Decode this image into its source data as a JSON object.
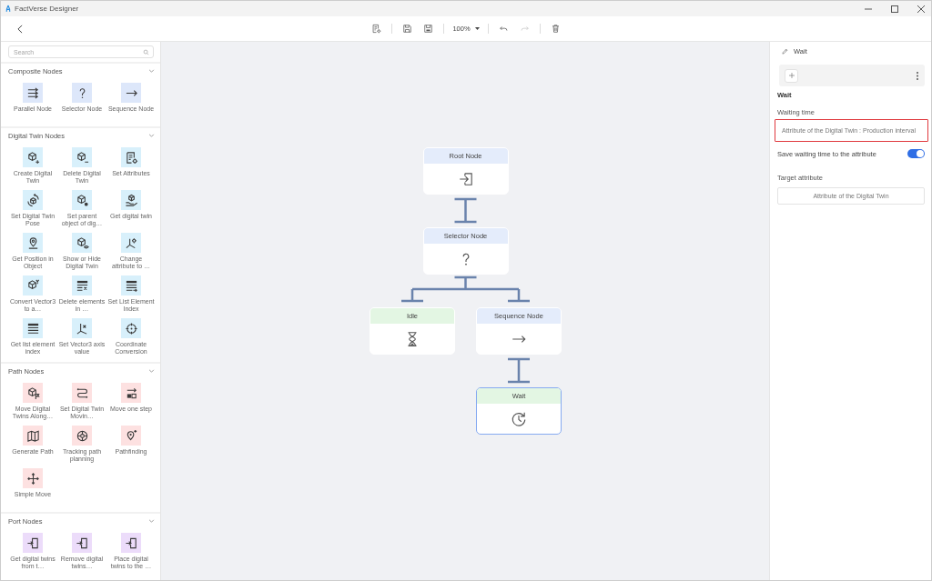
{
  "window": {
    "title": "FactVerse Designer"
  },
  "toolbar": {
    "zoom": "100%",
    "undo": {
      "disabled": false
    },
    "redo": {
      "disabled": true
    }
  },
  "sidebar": {
    "search": {
      "placeholder": "Search"
    },
    "sections": [
      {
        "title": "Composite Nodes",
        "expanded": true,
        "color": "#dde7fa",
        "items": [
          {
            "label": "Parallel Node"
          },
          {
            "label": "Selector Node"
          },
          {
            "label": "Sequence Node"
          }
        ]
      },
      {
        "title": "Digital Twin Nodes",
        "expanded": true,
        "color": "#d8f0fb",
        "items": [
          {
            "label": "Create Digital Twin"
          },
          {
            "label": "Delete Digital Twin"
          },
          {
            "label": "Set Attributes"
          },
          {
            "label": "Set Digital Twin Pose"
          },
          {
            "label": "Set parent object of dig…"
          },
          {
            "label": "Get digital twin"
          },
          {
            "label": "Get Position in Object"
          },
          {
            "label": "Show or Hide Digital Twin"
          },
          {
            "label": "Change attribute to …"
          },
          {
            "label": "Convert Vector3 to a…"
          },
          {
            "label": "Delete elements in …"
          },
          {
            "label": "Set List Element Index"
          },
          {
            "label": "Get list element index"
          },
          {
            "label": "Set Vector3 axis value"
          },
          {
            "label": "Coordinate Conversion"
          }
        ]
      },
      {
        "title": "Path Nodes",
        "expanded": true,
        "color": "#fde1e1",
        "items": [
          {
            "label": "Move Digital Twins Along…"
          },
          {
            "label": "Set Digital Twin Movin…"
          },
          {
            "label": "Move one step"
          },
          {
            "label": "Generate Path"
          },
          {
            "label": "Tracking path planning"
          },
          {
            "label": "Pathfinding"
          },
          {
            "label": "Simple Move"
          }
        ]
      },
      {
        "title": "Port Nodes",
        "expanded": true,
        "color": "#ecdcfa",
        "items": [
          {
            "label": "Get digital twins from t…"
          },
          {
            "label": "Remove digital twins…"
          },
          {
            "label": "Place digital twins to the …"
          }
        ]
      }
    ]
  },
  "canvas": {
    "nodes": [
      {
        "title": "Root Node",
        "kind": "root",
        "selected": false,
        "children": [
          {
            "title": "Selector Node",
            "kind": "selector",
            "selected": false,
            "children": [
              {
                "title": "Idle",
                "kind": "idle",
                "selected": false
              },
              {
                "title": "Sequence Node",
                "kind": "sequence",
                "selected": false,
                "children": [
                  {
                    "title": "Wait",
                    "kind": "wait",
                    "selected": true
                  }
                ]
              }
            ]
          }
        ]
      }
    ]
  },
  "inspector": {
    "title": "Wait",
    "heading": "Wait",
    "fields": [
      {
        "kind": "input",
        "label": "Waiting time",
        "value": "Attribute of the Digital Twin : Production interval",
        "highlighted": true
      },
      {
        "kind": "toggle",
        "label": "Save waiting time to the attribute",
        "on": true
      },
      {
        "kind": "picker",
        "label": "Target attribute",
        "value": "Attribute of the Digital Twin",
        "highlighted": false
      }
    ]
  }
}
